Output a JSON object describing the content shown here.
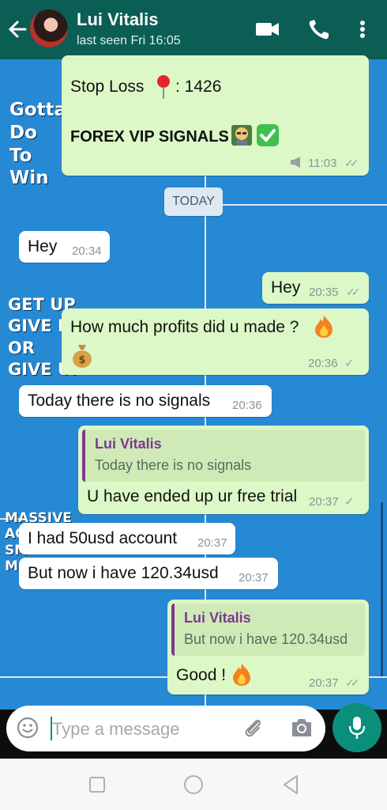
{
  "header": {
    "contact_name": "Lui Vitalis",
    "last_seen": "last seen Fri 16:05",
    "icons": [
      "back-arrow-icon",
      "video-call-icon",
      "phone-icon",
      "more-menu-icon"
    ]
  },
  "wallpaper_text": {
    "block1": [
      "Gotta",
      "Do",
      "To",
      "Win"
    ],
    "block2": [
      "GET UP",
      "GIVE IT",
      "OR",
      "GIVE UP"
    ],
    "block3": [
      "MASSIVE",
      "AC",
      "SM",
      "M"
    ]
  },
  "messages": {
    "m1": {
      "line1": "Stop Loss",
      "line1b": ": 1426",
      "line2": "FOREX VIP SIGNALS",
      "time": "11:03"
    },
    "date_divider": "TODAY",
    "m2": {
      "text": "Hey",
      "time": "20:34"
    },
    "m3": {
      "text": "Hey",
      "time": "20:35"
    },
    "m4": {
      "text": "How much profits did u made ?",
      "time": "20:36"
    },
    "m5": {
      "text": "Today there is no signals",
      "time": "20:36"
    },
    "m6": {
      "quote_name": "Lui Vitalis",
      "quote_text": "Today there is no signals",
      "text": "U have ended up ur free trial",
      "time": "20:37"
    },
    "m7": {
      "text": "I had 50usd account",
      "time": "20:37"
    },
    "m8": {
      "text": "But now i have 120.34usd",
      "time": "20:37"
    },
    "m9": {
      "quote_name": "Lui Vitalis",
      "quote_text": "But now i have 120.34usd",
      "text": "Good !",
      "time": "20:37"
    }
  },
  "input": {
    "placeholder": "Type a message"
  },
  "colors": {
    "header": "#0a5e54",
    "outgoing": "#dcf8c6",
    "incoming": "#ffffff",
    "accent": "#0a8f7a",
    "quote_name": "#7b3b8c"
  }
}
